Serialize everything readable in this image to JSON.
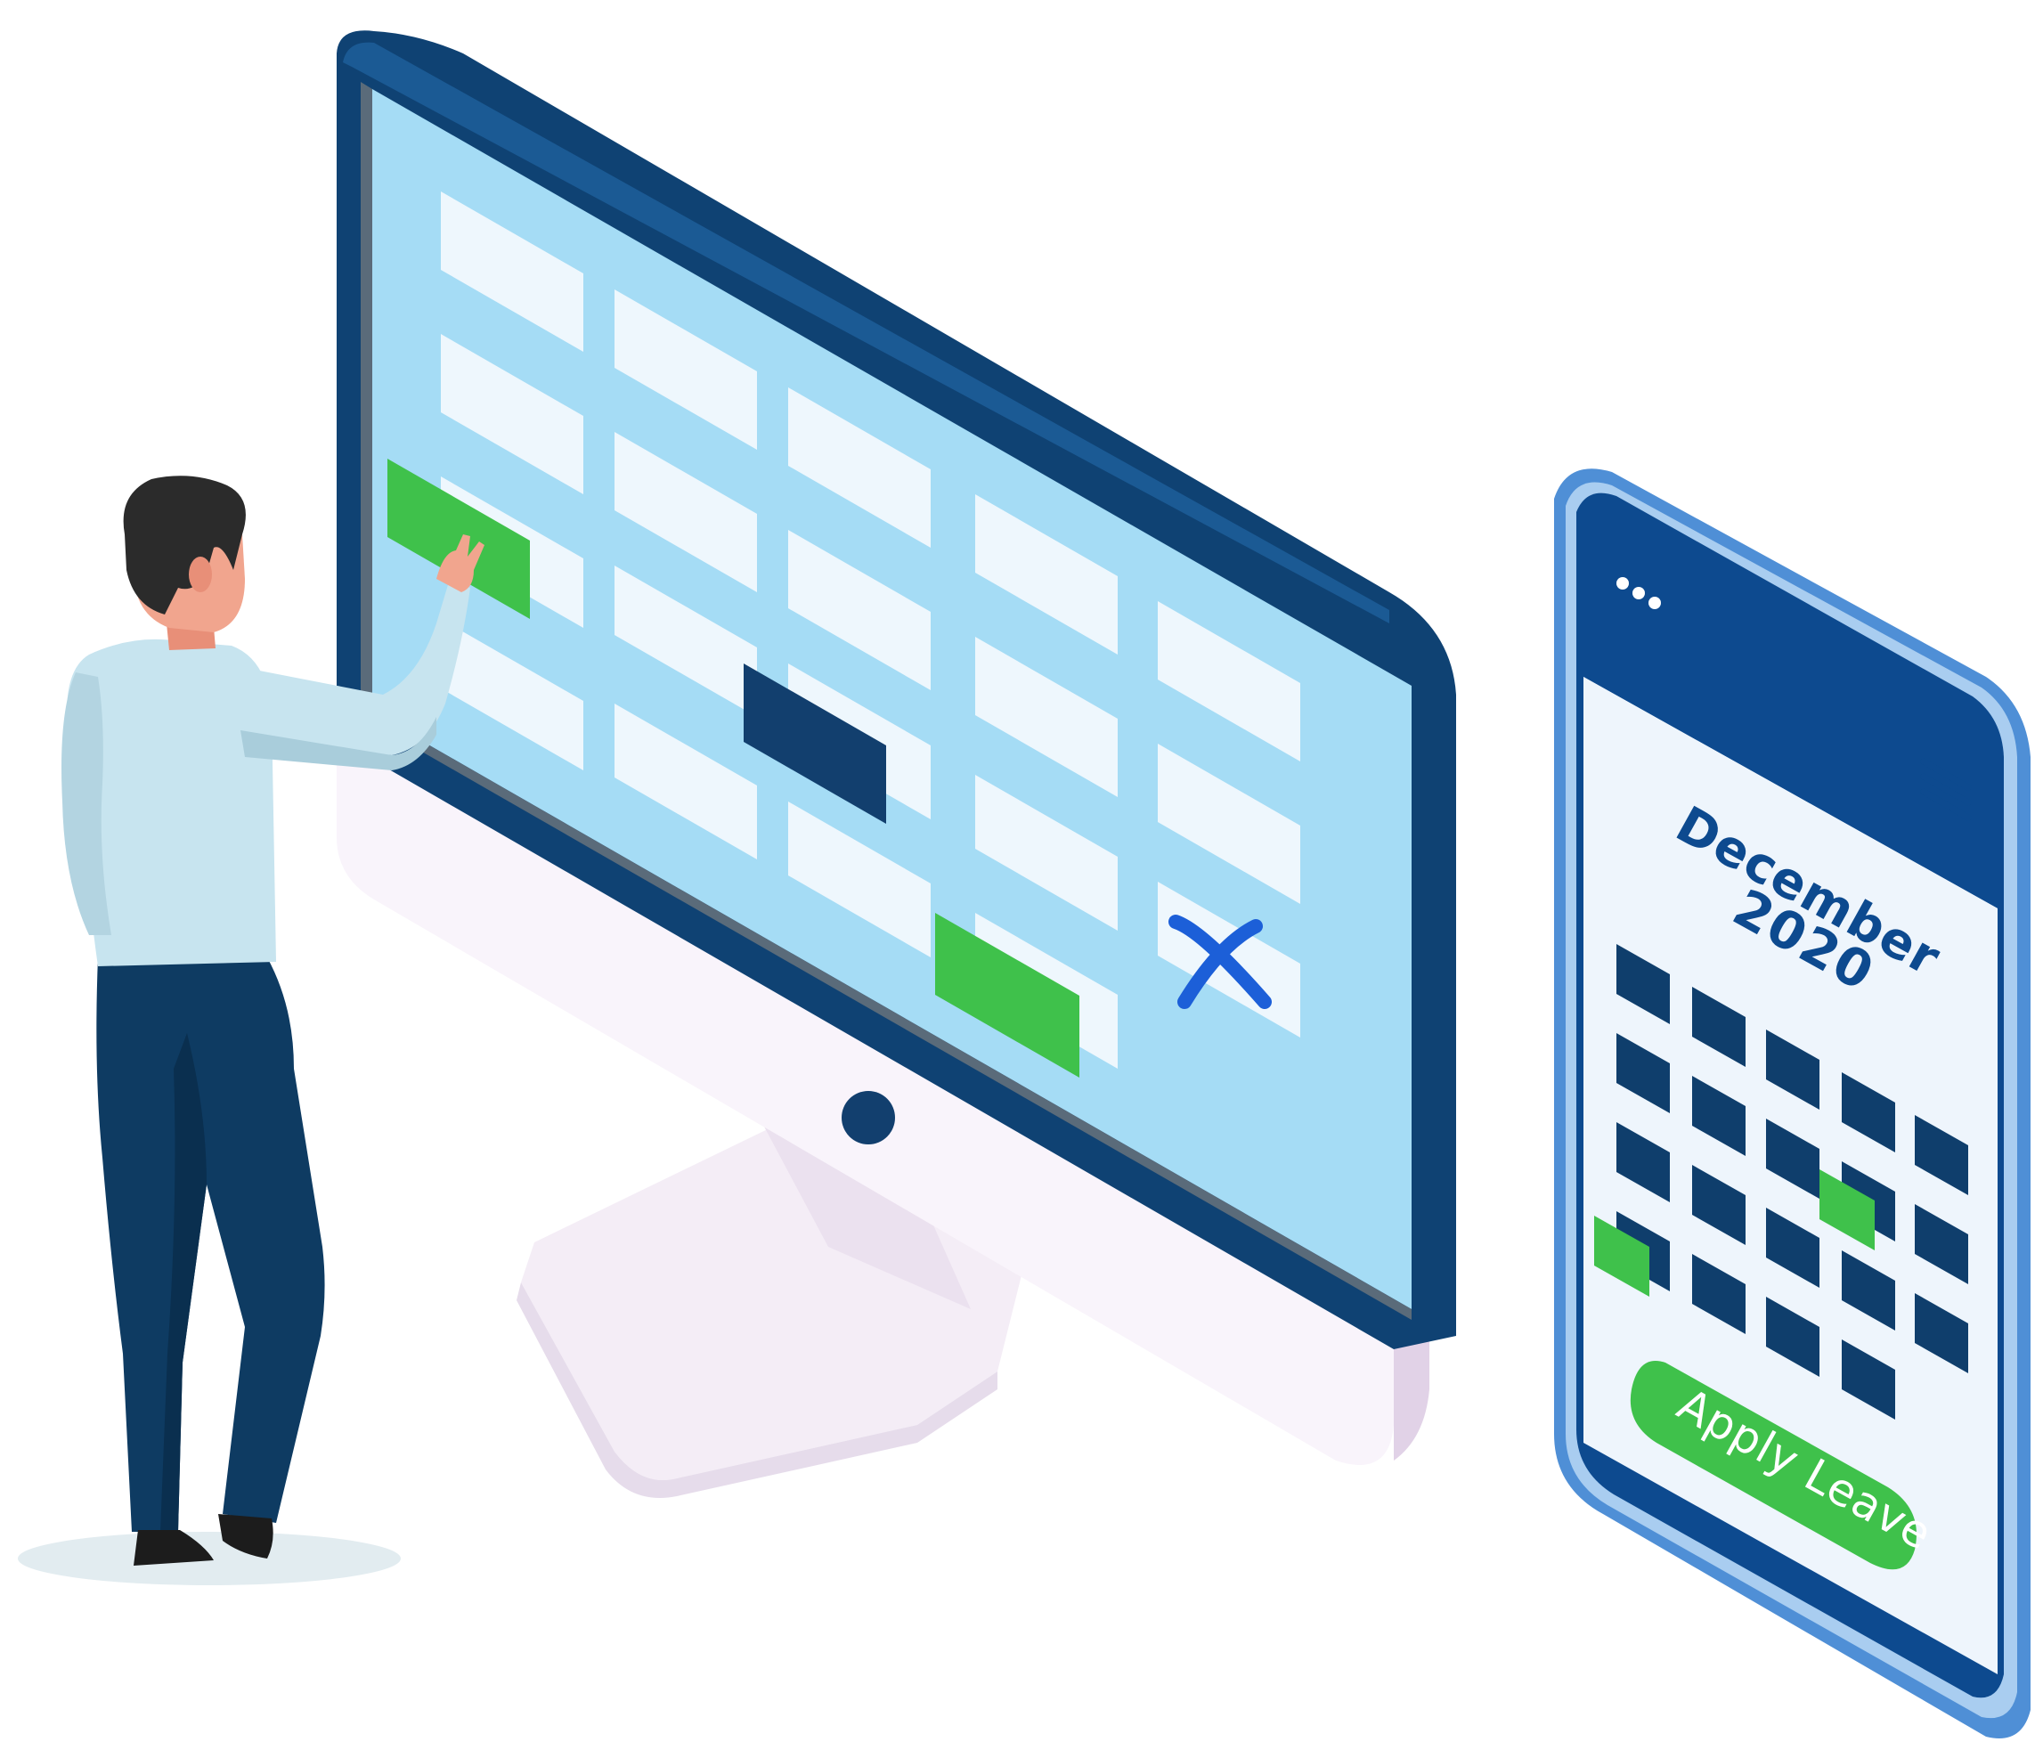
{
  "colors": {
    "background": "#ffffff",
    "monitor_bezel": "#0f4273",
    "monitor_screen": "#a5dcf5",
    "monitor_body": "#f9f4fb",
    "calendar_cell": "#eef7fd",
    "selected_cell": "#3fc14b",
    "blocked_cell": "#123f6e",
    "reject_mark": "#1c5fd8",
    "phone_frame": "#4f8fd6",
    "phone_body": "#0d4a8f",
    "phone_screen": "#eef5fc",
    "phone_cell": "#0f3e6c",
    "apply_button": "#3fc14b",
    "shirt": "#c7e4ef",
    "trousers": "#0e3b62",
    "hair": "#2b2b2b",
    "skin": "#f1a58e"
  },
  "icons": {
    "reject": "x-mark-icon",
    "phone_options": "more-dots-icon",
    "phone_menu": "hamburger-menu-icon"
  },
  "phone": {
    "month": "December",
    "year": "2020",
    "apply_button_label": "Apply Leave"
  }
}
